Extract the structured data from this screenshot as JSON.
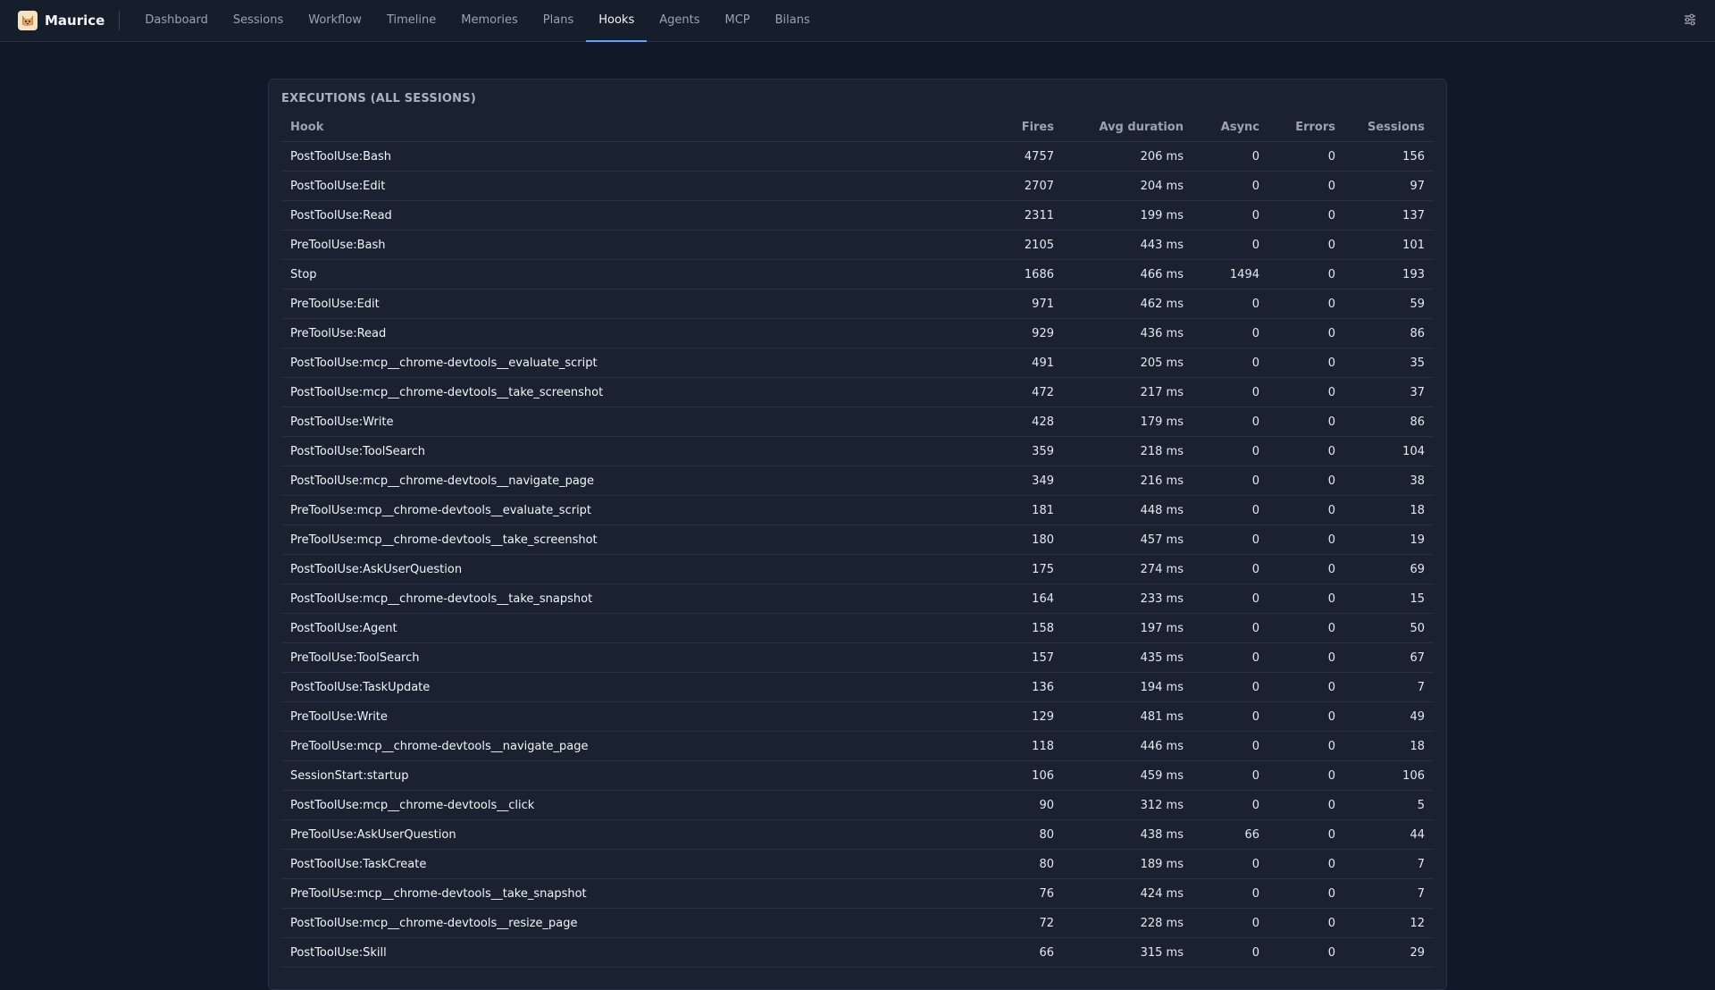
{
  "app": {
    "name": "Maurice",
    "logo_icon": "cat-logo-icon"
  },
  "nav": {
    "items": [
      {
        "label": "Dashboard"
      },
      {
        "label": "Sessions"
      },
      {
        "label": "Workflow"
      },
      {
        "label": "Timeline"
      },
      {
        "label": "Memories"
      },
      {
        "label": "Plans"
      },
      {
        "label": "Hooks",
        "active": true
      },
      {
        "label": "Agents"
      },
      {
        "label": "MCP"
      },
      {
        "label": "Bilans"
      }
    ],
    "settings_icon": "sliders-icon"
  },
  "executions": {
    "title": "EXECUTIONS (ALL SESSIONS)",
    "columns": {
      "hook": "Hook",
      "fires": "Fires",
      "avg": "Avg duration",
      "async": "Async",
      "errors": "Errors",
      "sessions": "Sessions"
    },
    "rows": [
      {
        "hook": "PostToolUse:Bash",
        "fires": "4757",
        "avg": "206 ms",
        "async": "0",
        "errors": "0",
        "sessions": "156"
      },
      {
        "hook": "PostToolUse:Edit",
        "fires": "2707",
        "avg": "204 ms",
        "async": "0",
        "errors": "0",
        "sessions": "97"
      },
      {
        "hook": "PostToolUse:Read",
        "fires": "2311",
        "avg": "199 ms",
        "async": "0",
        "errors": "0",
        "sessions": "137"
      },
      {
        "hook": "PreToolUse:Bash",
        "fires": "2105",
        "avg": "443 ms",
        "async": "0",
        "errors": "0",
        "sessions": "101"
      },
      {
        "hook": "Stop",
        "fires": "1686",
        "avg": "466 ms",
        "async": "1494",
        "errors": "0",
        "sessions": "193"
      },
      {
        "hook": "PreToolUse:Edit",
        "fires": "971",
        "avg": "462 ms",
        "async": "0",
        "errors": "0",
        "sessions": "59"
      },
      {
        "hook": "PreToolUse:Read",
        "fires": "929",
        "avg": "436 ms",
        "async": "0",
        "errors": "0",
        "sessions": "86"
      },
      {
        "hook": "PostToolUse:mcp__chrome-devtools__evaluate_script",
        "fires": "491",
        "avg": "205 ms",
        "async": "0",
        "errors": "0",
        "sessions": "35"
      },
      {
        "hook": "PostToolUse:mcp__chrome-devtools__take_screenshot",
        "fires": "472",
        "avg": "217 ms",
        "async": "0",
        "errors": "0",
        "sessions": "37"
      },
      {
        "hook": "PostToolUse:Write",
        "fires": "428",
        "avg": "179 ms",
        "async": "0",
        "errors": "0",
        "sessions": "86"
      },
      {
        "hook": "PostToolUse:ToolSearch",
        "fires": "359",
        "avg": "218 ms",
        "async": "0",
        "errors": "0",
        "sessions": "104"
      },
      {
        "hook": "PostToolUse:mcp__chrome-devtools__navigate_page",
        "fires": "349",
        "avg": "216 ms",
        "async": "0",
        "errors": "0",
        "sessions": "38"
      },
      {
        "hook": "PreToolUse:mcp__chrome-devtools__evaluate_script",
        "fires": "181",
        "avg": "448 ms",
        "async": "0",
        "errors": "0",
        "sessions": "18"
      },
      {
        "hook": "PreToolUse:mcp__chrome-devtools__take_screenshot",
        "fires": "180",
        "avg": "457 ms",
        "async": "0",
        "errors": "0",
        "sessions": "19"
      },
      {
        "hook": "PostToolUse:AskUserQuestion",
        "fires": "175",
        "avg": "274 ms",
        "async": "0",
        "errors": "0",
        "sessions": "69"
      },
      {
        "hook": "PostToolUse:mcp__chrome-devtools__take_snapshot",
        "fires": "164",
        "avg": "233 ms",
        "async": "0",
        "errors": "0",
        "sessions": "15"
      },
      {
        "hook": "PostToolUse:Agent",
        "fires": "158",
        "avg": "197 ms",
        "async": "0",
        "errors": "0",
        "sessions": "50"
      },
      {
        "hook": "PreToolUse:ToolSearch",
        "fires": "157",
        "avg": "435 ms",
        "async": "0",
        "errors": "0",
        "sessions": "67"
      },
      {
        "hook": "PostToolUse:TaskUpdate",
        "fires": "136",
        "avg": "194 ms",
        "async": "0",
        "errors": "0",
        "sessions": "7"
      },
      {
        "hook": "PreToolUse:Write",
        "fires": "129",
        "avg": "481 ms",
        "async": "0",
        "errors": "0",
        "sessions": "49"
      },
      {
        "hook": "PreToolUse:mcp__chrome-devtools__navigate_page",
        "fires": "118",
        "avg": "446 ms",
        "async": "0",
        "errors": "0",
        "sessions": "18"
      },
      {
        "hook": "SessionStart:startup",
        "fires": "106",
        "avg": "459 ms",
        "async": "0",
        "errors": "0",
        "sessions": "106"
      },
      {
        "hook": "PostToolUse:mcp__chrome-devtools__click",
        "fires": "90",
        "avg": "312 ms",
        "async": "0",
        "errors": "0",
        "sessions": "5"
      },
      {
        "hook": "PreToolUse:AskUserQuestion",
        "fires": "80",
        "avg": "438 ms",
        "async": "66",
        "errors": "0",
        "sessions": "44"
      },
      {
        "hook": "PostToolUse:TaskCreate",
        "fires": "80",
        "avg": "189 ms",
        "async": "0",
        "errors": "0",
        "sessions": "7"
      },
      {
        "hook": "PreToolUse:mcp__chrome-devtools__take_snapshot",
        "fires": "76",
        "avg": "424 ms",
        "async": "0",
        "errors": "0",
        "sessions": "7"
      },
      {
        "hook": "PostToolUse:mcp__chrome-devtools__resize_page",
        "fires": "72",
        "avg": "228 ms",
        "async": "0",
        "errors": "0",
        "sessions": "12"
      },
      {
        "hook": "PostToolUse:Skill",
        "fires": "66",
        "avg": "315 ms",
        "async": "0",
        "errors": "0",
        "sessions": "29"
      }
    ]
  }
}
